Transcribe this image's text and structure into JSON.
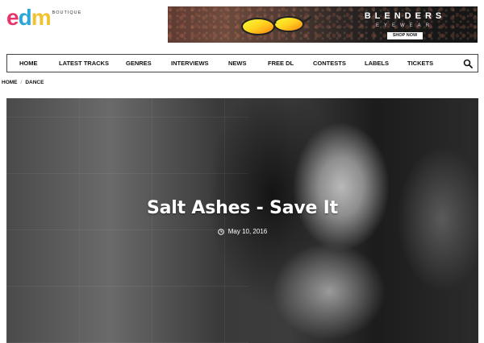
{
  "site": {
    "logo_text": "edm",
    "logo_subtext": "BOUTIQUE"
  },
  "ad": {
    "brand": "BLENDERS",
    "subbrand": "EYEWEAR",
    "cta": "SHOP NOW"
  },
  "nav": {
    "items": [
      "HOME",
      "LATEST TRACKS",
      "GENRES",
      "INTERVIEWS",
      "NEWS",
      "FREE DL",
      "CONTESTS",
      "LABELS",
      "TICKETS"
    ],
    "search_icon": "search-icon"
  },
  "breadcrumb": [
    "HOME",
    "DANCE"
  ],
  "post": {
    "title": "Salt Ashes - Save It",
    "date": "May 10, 2016",
    "date_icon": "clock-icon"
  },
  "colors": {
    "logo_e": "#e8336b",
    "logo_d": "#2ba8d8",
    "logo_m": "#f2c230"
  }
}
